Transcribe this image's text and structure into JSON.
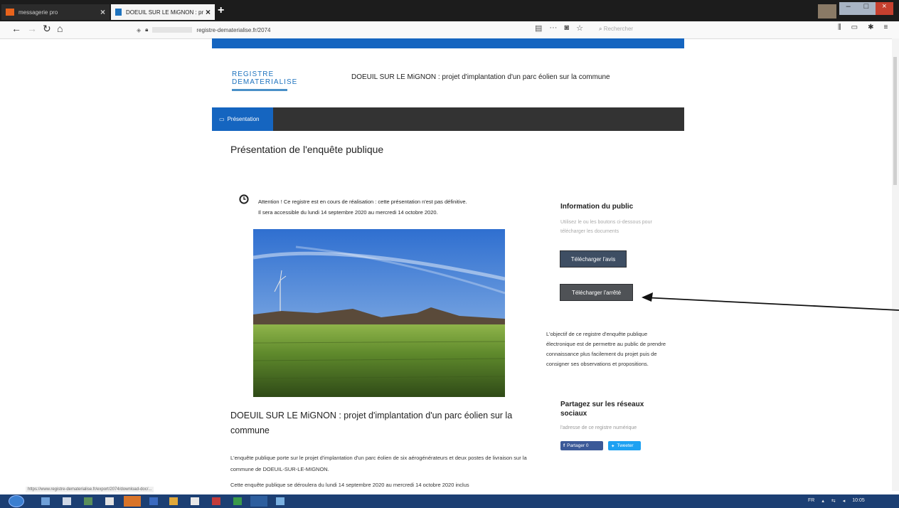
{
  "browser": {
    "tabs": [
      {
        "label": "messagerie pro"
      },
      {
        "label": "DOEUIL SUR LE MiGNON : pr"
      }
    ],
    "url": "registre-dematerialise.fr/2074",
    "search_placeholder": "Rechercher"
  },
  "page": {
    "banner_text": "",
    "logo_text": "REGISTRE DEMATERIALISE",
    "header_title": "DOEUIL SUR LE MiGNON : projet d'implantation d'un parc éolien sur la commune",
    "nav_tab": "Présentation",
    "heading": "Présentation de l'enquête publique",
    "notice_line1": "Attention ! Ce registre est en cours de réalisation : cette présentation n'est pas définitive.",
    "notice_line2": "Il sera accessible du lundi 14 septembre 2020 au mercredi 14 octobre 2020.",
    "section_title": "DOEUIL SUR LE MiGNON : projet d'implantation d'un parc éolien sur la commune",
    "paragraph1": "L'enquête publique porte sur le projet d'implantation d'un parc éolien de six aérogénérateurs et deux postes de livraison sur la commune de DOEUIL-SUR-LE-MIGNON.",
    "paragraph2": "Cette enquête publique se déroulera du lundi 14 septembre 2020 au mercredi 14 octobre 2020 inclus"
  },
  "sidebar": {
    "info_title": "Information du public",
    "info_text": "Utilisez le ou les boutons ci-dessous pour télécharger les documents",
    "btn_avis": "Télécharger l'avis",
    "btn_arrete": "Télécharger l'arrêté",
    "objective": "L'objectif de ce registre d'enquête publique électronique est de permettre au public de prendre connaissance plus facilement du projet puis de consigner ses observations et propositions.",
    "share_title": "Partagez sur les réseaux sociaux",
    "share_text": "l'adresse de ce registre numérique",
    "fb_label": "Partager 0",
    "tw_label": "Tweeter"
  },
  "status_url": "https://www.registre-dematerialise.fr/export/2074/download-doc/...",
  "tray": {
    "lang": "FR",
    "time": "10:05"
  },
  "colors": {
    "accent_blue": "#1565c0",
    "nav_dark": "#333333",
    "taskbar": "#1c3f73"
  }
}
